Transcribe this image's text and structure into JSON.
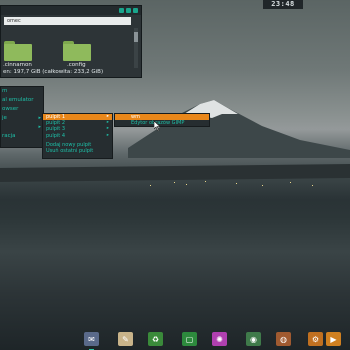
{
  "clock": {
    "time": "23:48"
  },
  "file_manager": {
    "path": "omec",
    "folders": [
      {
        "label": ".cinnamon",
        "icon": "folder-icon"
      },
      {
        "label": ".config",
        "icon": "folder-icon"
      }
    ],
    "status": "en: 197,7 GiB (całkowita: 233,2 GiB)",
    "accent_color": "#1aa58c"
  },
  "menu": {
    "items": [
      {
        "label": "m",
        "has_submenu": false
      },
      {
        "label": "al emulator",
        "has_submenu": false
      },
      {
        "label": "owser",
        "has_submenu": false
      },
      {
        "label": "je",
        "has_submenu": true
      },
      {
        "label": "",
        "has_submenu": true
      },
      {
        "label": "racja",
        "has_submenu": false
      }
    ],
    "accent_color": "#1ec0a8"
  },
  "submenu": {
    "items": [
      {
        "label": "pulpit 1",
        "active": true,
        "has_submenu": true
      },
      {
        "label": "pulpit 2",
        "active": false,
        "has_submenu": true
      },
      {
        "label": "pulpit 3",
        "active": false,
        "has_submenu": true
      },
      {
        "label": "pulpit 4",
        "active": false,
        "has_submenu": true
      }
    ],
    "actions": [
      {
        "label": "Dodaj nowy pulpit"
      },
      {
        "label": "Usuń ostatni pulpit"
      }
    ],
    "highlight_color": "#e9871a"
  },
  "submenu2": {
    "items": [
      {
        "label": "wm",
        "active": true
      },
      {
        "label": "Edytor obrazów GIMP",
        "active": false
      }
    ]
  },
  "dock": {
    "icons": [
      {
        "name": "stamp-app-icon",
        "color": "#5a6a8a",
        "glyph": "✉"
      },
      {
        "name": "notes-app-icon",
        "color": "#c9b48a",
        "glyph": "✎"
      },
      {
        "name": "recycle-app-icon",
        "color": "#3a8a3a",
        "glyph": "♻"
      },
      {
        "name": "terminal-app-icon",
        "color": "#2d8a3d",
        "glyph": "▢"
      },
      {
        "name": "color-wheel-icon",
        "color": "#b040b0",
        "glyph": "✺"
      },
      {
        "name": "eye-viewer-icon",
        "color": "#3f7a4a",
        "glyph": "◉"
      },
      {
        "name": "globe-app-icon",
        "color": "#a05a30",
        "glyph": "◍"
      },
      {
        "name": "mixer-app-icon",
        "color": "#c07020",
        "glyph": "⚙"
      },
      {
        "name": "media-player-icon",
        "color": "#d08020",
        "glyph": "▶"
      }
    ]
  }
}
